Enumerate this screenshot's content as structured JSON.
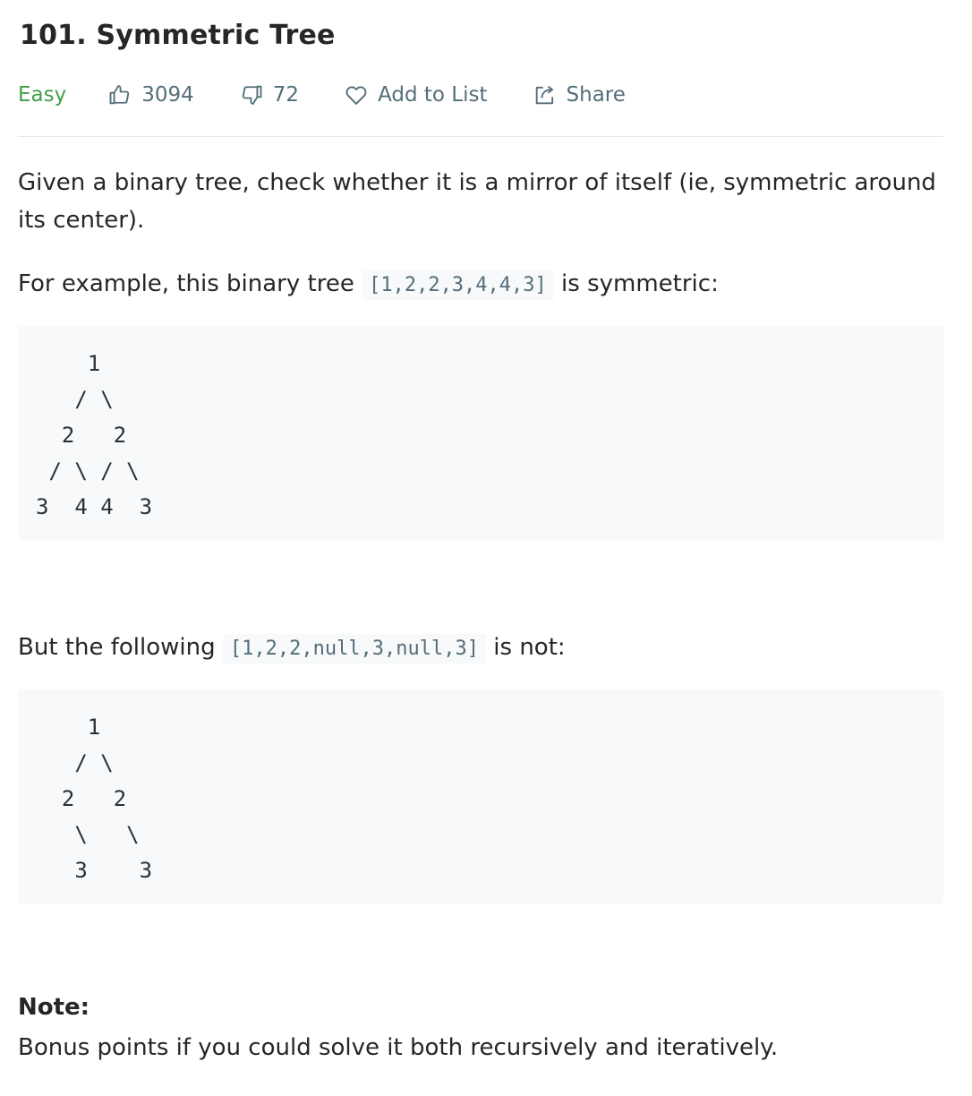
{
  "problem": {
    "title": "101. Symmetric Tree",
    "difficulty": "Easy",
    "likes": "3094",
    "dislikes": "72",
    "add_to_list_label": "Add to List",
    "share_label": "Share"
  },
  "description": {
    "intro": "Given a binary tree, check whether it is a mirror of itself (ie, symmetric around its center).",
    "example1_prefix": "For example, this binary tree",
    "example1_code": "[1,2,2,3,4,4,3]",
    "example1_suffix": "is symmetric:",
    "tree1": "    1\n   / \\\n  2   2\n / \\ / \\\n3  4 4  3",
    "example2_prefix": "But the following",
    "example2_code": "[1,2,2,null,3,null,3]",
    "example2_suffix": "is not:",
    "tree2": "    1\n   / \\\n  2   2\n   \\   \\\n   3    3",
    "note_label": "Note:",
    "note_text": "Bonus points if you could solve it both recursively and iteratively."
  },
  "colors": {
    "difficulty_easy": "#43a047",
    "meta_text": "#546e7a",
    "code_bg": "#f7f9fa"
  },
  "icons": {
    "likes": "thumbs-up-icon",
    "dislikes": "thumbs-down-icon",
    "add_to_list": "heart-icon",
    "share": "share-icon"
  }
}
